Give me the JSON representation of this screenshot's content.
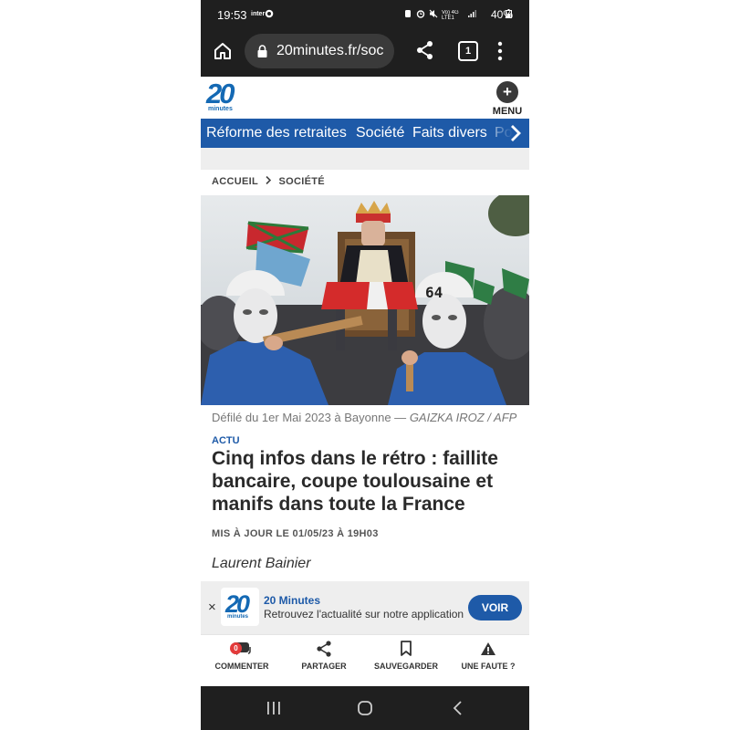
{
  "status_bar": {
    "time": "19:53",
    "carrier": "inter",
    "network": "Vo) 4G LTE1",
    "battery": "40%"
  },
  "browser": {
    "url": "20minutes.fr/soc",
    "tab_count": "1"
  },
  "site": {
    "logo_number": "20",
    "logo_word": "minutes",
    "menu_label": "MENU"
  },
  "nav": {
    "items": [
      "Réforme des retraites",
      "Société",
      "Faits divers",
      "Po"
    ]
  },
  "breadcrumb": {
    "home": "ACCUEIL",
    "section": "SOCIÉTÉ"
  },
  "article": {
    "image_sign_text": "64",
    "caption_text": "Défilé du 1er Mai 2023 à Bayonne —",
    "caption_credit": "GAIZKA IROZ / AFP",
    "kicker": "ACTU",
    "title": "Cinq infos dans le rétro : faillite bancaire, coupe toulousaine et manifs dans toute la France",
    "updated": "MIS À JOUR LE 01/05/23 À 19H03",
    "author": "Laurent Bainier"
  },
  "app_banner": {
    "close": "×",
    "logo_number": "20",
    "logo_word": "minutes",
    "title": "20 Minutes",
    "subtitle": "Retrouvez l'actualité sur notre application",
    "button": "VOIR"
  },
  "actions": {
    "comment_count": "0",
    "comment": "COMMENTER",
    "share": "PARTAGER",
    "save": "SAUVEGARDER",
    "report": "UNE FAUTE ?"
  },
  "colors": {
    "brand_blue": "#1e5aa8",
    "dark_bar": "#1f1f1f"
  }
}
